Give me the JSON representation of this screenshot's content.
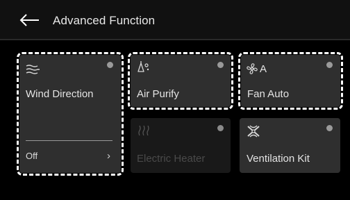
{
  "header": {
    "back_icon": "arrow-left-icon",
    "title": "Advanced Function"
  },
  "cards": {
    "wind_direction": {
      "label": "Wind Direction",
      "icon": "wind-icon",
      "status": "Off",
      "chevron": "›",
      "selected": true
    },
    "air_purify": {
      "label": "Air Purify",
      "icon": "air-purify-icon",
      "selected": true
    },
    "fan_auto": {
      "label": "Fan Auto",
      "icon": "fan-icon",
      "icon_text": "A",
      "selected": true
    },
    "electric_heater": {
      "label": "Electric Heater",
      "icon": "heater-icon",
      "disabled": true
    },
    "ventilation_kit": {
      "label": "Ventilation Kit",
      "icon": "ventilation-icon"
    }
  },
  "colors": {
    "background": "#000000",
    "header": "#111111",
    "card": "#2f2f2f",
    "card_disabled": "#191919",
    "dot": "#9a9a9a",
    "selection_outline": "#ffffff"
  }
}
